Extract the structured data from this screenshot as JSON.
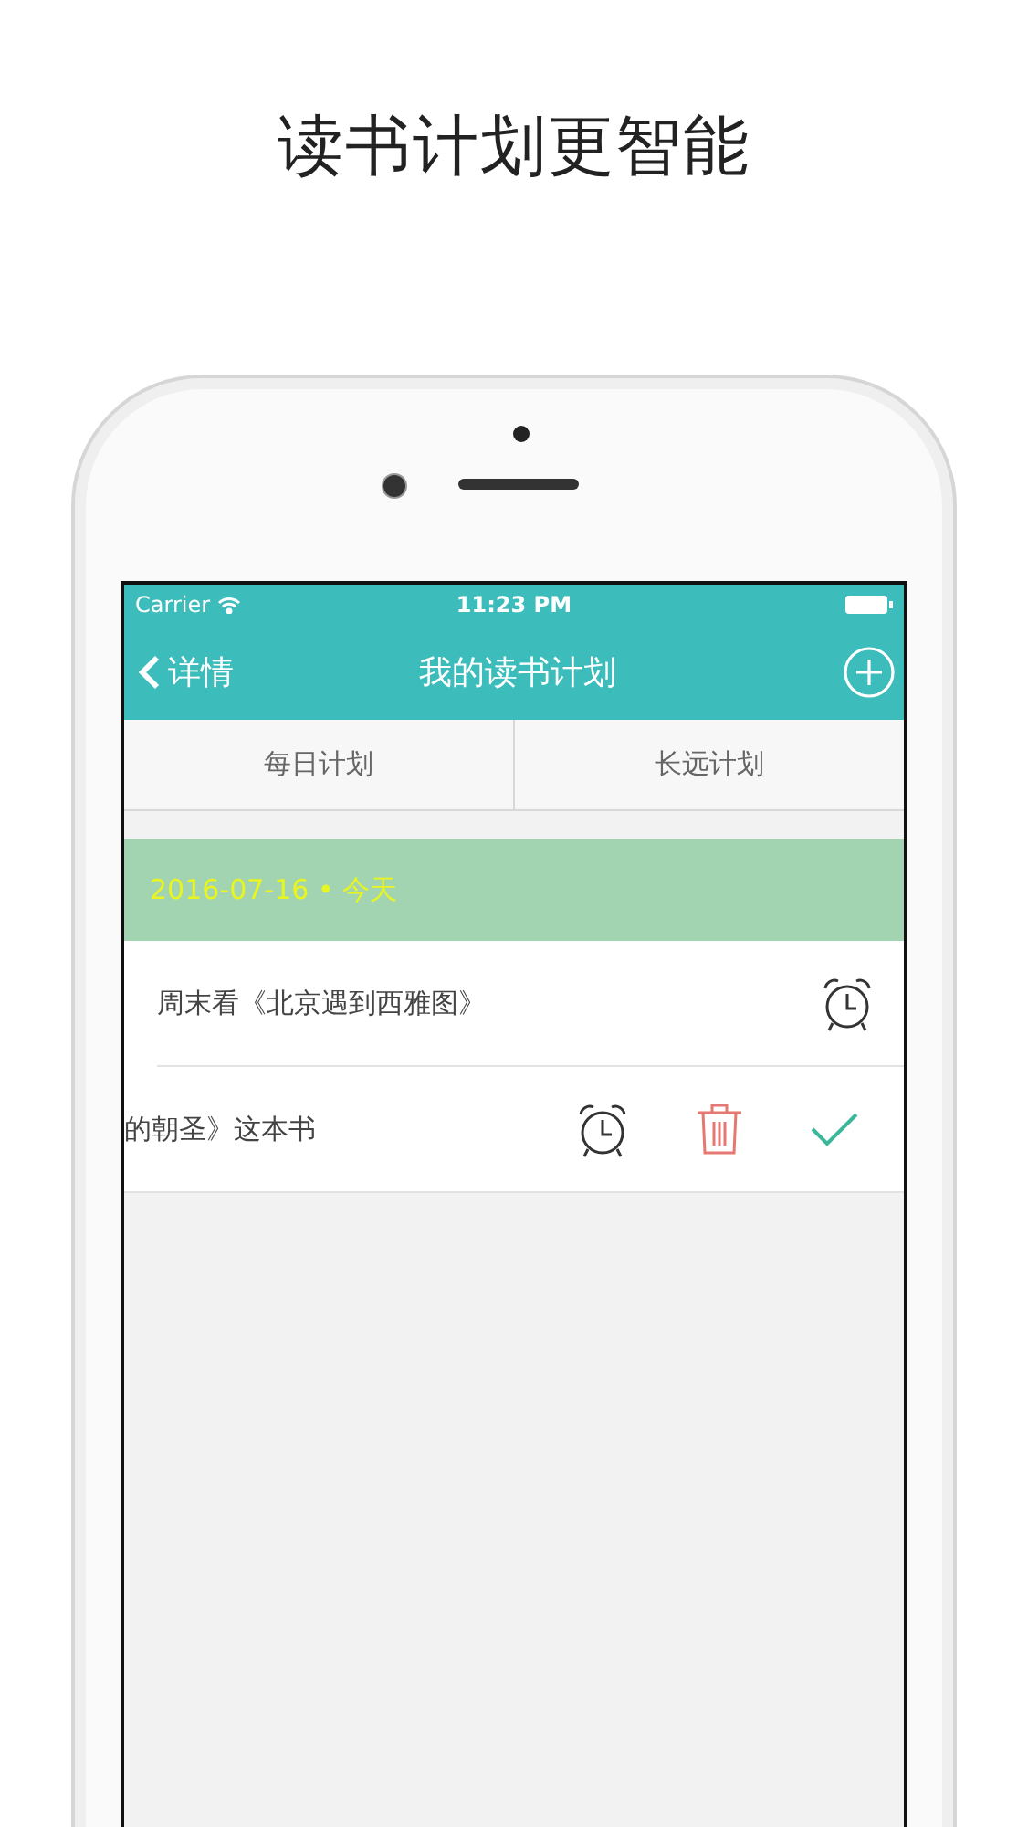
{
  "headline": "读书计划更智能",
  "status_bar": {
    "carrier": "Carrier",
    "time": "11:23 PM"
  },
  "nav": {
    "back": "详情",
    "title": "我的读书计划"
  },
  "tabs": [
    {
      "label": "每日计划"
    },
    {
      "label": "长远计划"
    }
  ],
  "section": {
    "title": "2016-07-16 • 今天"
  },
  "rows": [
    {
      "text": "周末看《北京遇到西雅图》",
      "swiped": false
    },
    {
      "text": "的朝圣》这本书",
      "swiped": true
    }
  ]
}
